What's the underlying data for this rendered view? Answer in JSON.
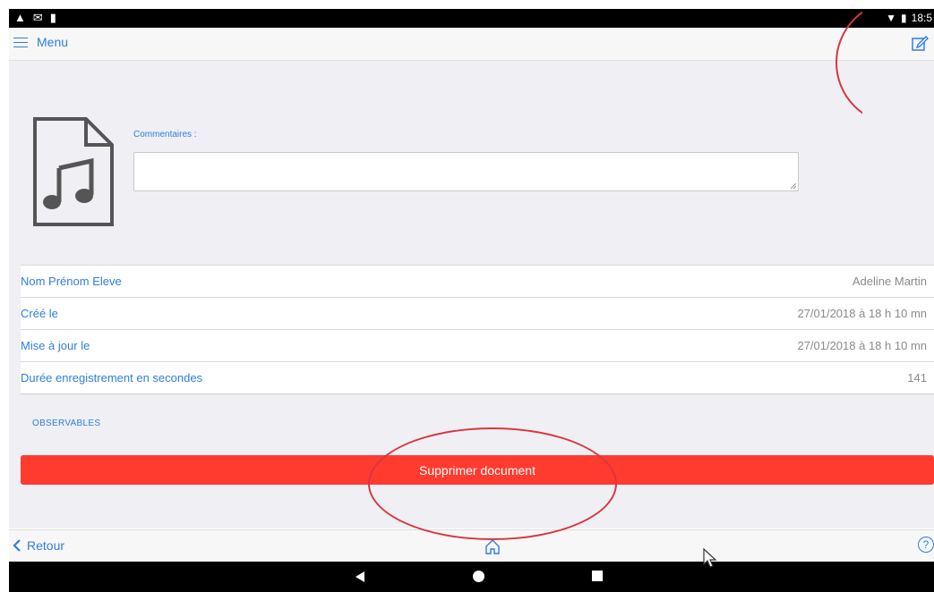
{
  "statusbar": {
    "time": "18:5"
  },
  "nav": {
    "menu_label": "Menu"
  },
  "comment": {
    "label": "Commentaires :",
    "value": ""
  },
  "details": [
    {
      "label": "Nom Prénom Eleve",
      "value": "Adeline Martin"
    },
    {
      "label": "Créé le",
      "value": "27/01/2018 à 18 h 10 mn"
    },
    {
      "label": "Mise à jour le",
      "value": "27/01/2018 à 18 h 10 mn"
    },
    {
      "label": "Durée enregistrement en secondes",
      "value": "141"
    }
  ],
  "section": {
    "observables": "OBSERVABLES"
  },
  "actions": {
    "delete_label": "Supprimer document"
  },
  "toolbar": {
    "back_label": "Retour",
    "help_label": "?"
  },
  "colors": {
    "accent": "#2f7de1",
    "danger": "#ff3b30",
    "annotation": "#d9363e",
    "background": "#efeff4"
  },
  "icons": [
    "hamburger-icon",
    "edit-icon",
    "audio-file-icon",
    "chevron-left-icon",
    "home-icon",
    "help-icon"
  ]
}
